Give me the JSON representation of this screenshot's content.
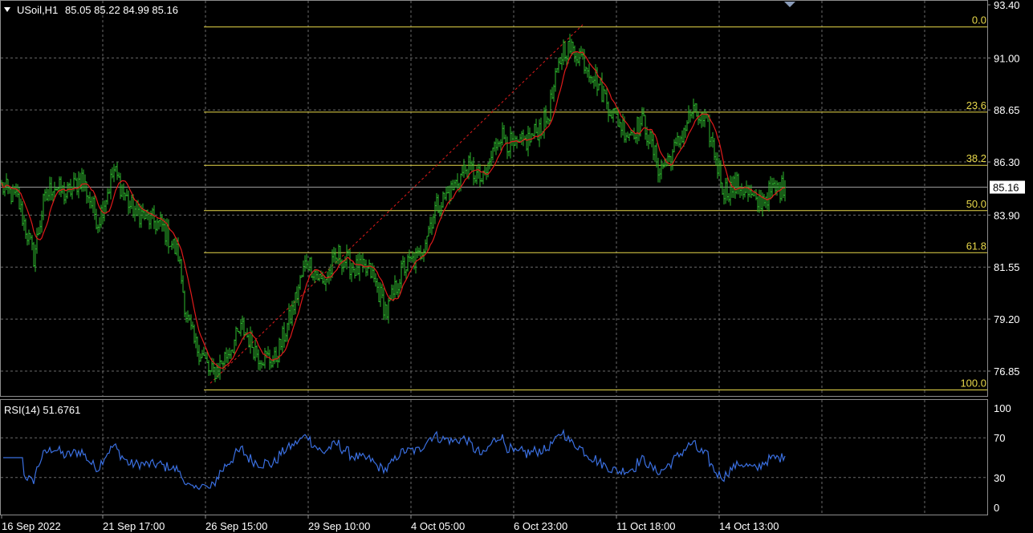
{
  "header": {
    "symbol": "USoil,H1",
    "ohlc": "85.05 85.22 84.99 85.16"
  },
  "rsi_header": "RSI(14) 51.6761",
  "colors": {
    "background": "#000000",
    "grid": "#6a6a6a",
    "candle": "#2eb82e",
    "moving_average": "#e01b1b",
    "fibonacci": "#e8d84a",
    "rsi_line": "#3a6fe0",
    "frame": "#8c8c8c"
  },
  "icons": {
    "collapse": "triangle-down-icon",
    "scroll_marker": "triangle-down-icon"
  },
  "chart_data": [
    {
      "type": "candlestick",
      "title": "USoil,H1",
      "ylim": [
        75.9,
        93.4
      ],
      "y_ticks": [
        "93.40",
        "91.00",
        "88.65",
        "86.30",
        "83.90",
        "81.55",
        "79.20",
        "76.85"
      ],
      "x_ticks": [
        "16 Sep 2022",
        "21 Sep 17:00",
        "26 Sep 15:00",
        "29 Sep 10:00",
        "4 Oct 05:00",
        "6 Oct 23:00",
        "11 Oct 18:00",
        "14 Oct 13:00"
      ],
      "current_price": "85.16",
      "last_bar": {
        "open": 85.05,
        "high": 85.22,
        "low": 84.99,
        "close": 85.16
      },
      "price_path": [
        [
          0,
          85.2
        ],
        [
          10,
          84.6
        ],
        [
          20,
          82.0
        ],
        [
          26,
          84.4
        ],
        [
          32,
          85.3
        ],
        [
          40,
          84.8
        ],
        [
          50,
          85.6
        ],
        [
          60,
          83.6
        ],
        [
          70,
          85.9
        ],
        [
          80,
          84.3
        ],
        [
          90,
          83.8
        ],
        [
          100,
          83.4
        ],
        [
          110,
          82.1
        ],
        [
          115,
          79.4
        ],
        [
          120,
          78.1
        ],
        [
          125,
          77.6
        ],
        [
          130,
          76.7
        ],
        [
          135,
          77.0
        ],
        [
          140,
          77.6
        ],
        [
          150,
          78.8
        ],
        [
          160,
          77.6
        ],
        [
          170,
          77.3
        ],
        [
          180,
          79.3
        ],
        [
          190,
          81.9
        ],
        [
          200,
          80.8
        ],
        [
          210,
          82.1
        ],
        [
          220,
          81.5
        ],
        [
          230,
          81.3
        ],
        [
          240,
          79.5
        ],
        [
          250,
          81.5
        ],
        [
          260,
          82.0
        ],
        [
          270,
          84.2
        ],
        [
          280,
          85.0
        ],
        [
          290,
          86.1
        ],
        [
          300,
          85.4
        ],
        [
          310,
          87.6
        ],
        [
          320,
          86.9
        ],
        [
          330,
          87.4
        ],
        [
          340,
          88.3
        ],
        [
          350,
          91.5
        ],
        [
          360,
          91.2
        ],
        [
          370,
          90.1
        ],
        [
          380,
          88.6
        ],
        [
          390,
          87.6
        ],
        [
          400,
          88.1
        ],
        [
          410,
          85.9
        ],
        [
          420,
          86.9
        ],
        [
          430,
          88.6
        ],
        [
          440,
          87.9
        ],
        [
          450,
          85.0
        ],
        [
          460,
          85.3
        ],
        [
          470,
          84.4
        ],
        [
          480,
          85.0
        ],
        [
          488,
          85.16
        ]
      ],
      "trend_line": {
        "from": [
          130,
          76.3
        ],
        "to": [
          362,
          92.5
        ]
      },
      "fibonacci_levels": [
        {
          "label": "0.0",
          "price": 92.4
        },
        {
          "label": "23.6",
          "price": 88.55
        },
        {
          "label": "38.2",
          "price": 86.15
        },
        {
          "label": "50.0",
          "price": 84.1
        },
        {
          "label": "61.8",
          "price": 82.2
        },
        {
          "label": "100.0",
          "price": 76.0
        }
      ]
    },
    {
      "type": "line",
      "title": "RSI(14) 51.6761",
      "ylim": [
        0,
        100
      ],
      "y_ticks": [
        "100",
        "70",
        "30",
        "0"
      ],
      "levels": [
        70,
        30
      ],
      "last_value": 51.6761
    }
  ]
}
